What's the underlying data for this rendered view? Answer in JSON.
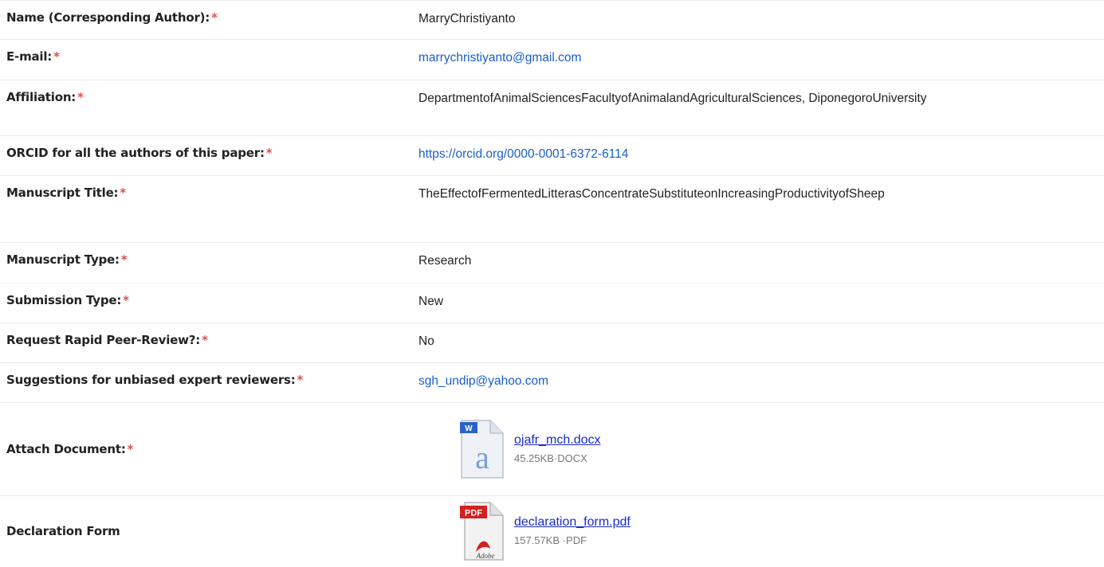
{
  "fields": [
    {
      "label": "Name (Corresponding Author):",
      "required": "*",
      "value": "MarryChristiyanto"
    },
    {
      "label": "E-mail:",
      "required": "*",
      "value": "marrychristiyanto@gmail.com"
    },
    {
      "label": "Affiliation:",
      "required": "*",
      "value": "DepartmentofAnimalSciencesFacultyofAnimalandAgriculturalSciences, DiponegoroUniversity"
    },
    {
      "label": "ORCID for all the authors of this paper:",
      "required": "*",
      "value": "https://orcid.org/0000-0001-6372-6114"
    },
    {
      "label": "Manuscript Title:",
      "required": "*",
      "value": "TheEffectofFermentedLitterasConcentrateSubstituteonIncreasingProductivityofSheep"
    },
    {
      "label": "Manuscript Type:",
      "required": "*",
      "value": "Research"
    },
    {
      "label": "Submission Type:",
      "required": "*",
      "value": "New"
    },
    {
      "label": "Request Rapid Peer-Review?:",
      "required": "*",
      "value": "No"
    },
    {
      "label": "Suggestions for unbiased expert reviewers:",
      "required": "*",
      "value": "sgh_undip@yahoo.com"
    }
  ],
  "attachments": [
    {
      "label": "Attach Document:",
      "required": "*",
      "filename": "ojafr_mch.docx",
      "meta": "45.25KB·DOCX",
      "icon": "word-doc-icon",
      "icon_letter": "a",
      "icon_badge": "W"
    },
    {
      "label": "Declaration Form",
      "filename": "declaration_form.pdf",
      "meta": "157.57KB ·PDF",
      "icon": "pdf-doc-icon",
      "icon_badge": "PDF",
      "icon_brand": "Adobe"
    }
  ],
  "colors": {
    "link": "#1a5fc8",
    "file_link": "#1a2bcc",
    "required": "#d9534f",
    "divider": "#ececec"
  }
}
